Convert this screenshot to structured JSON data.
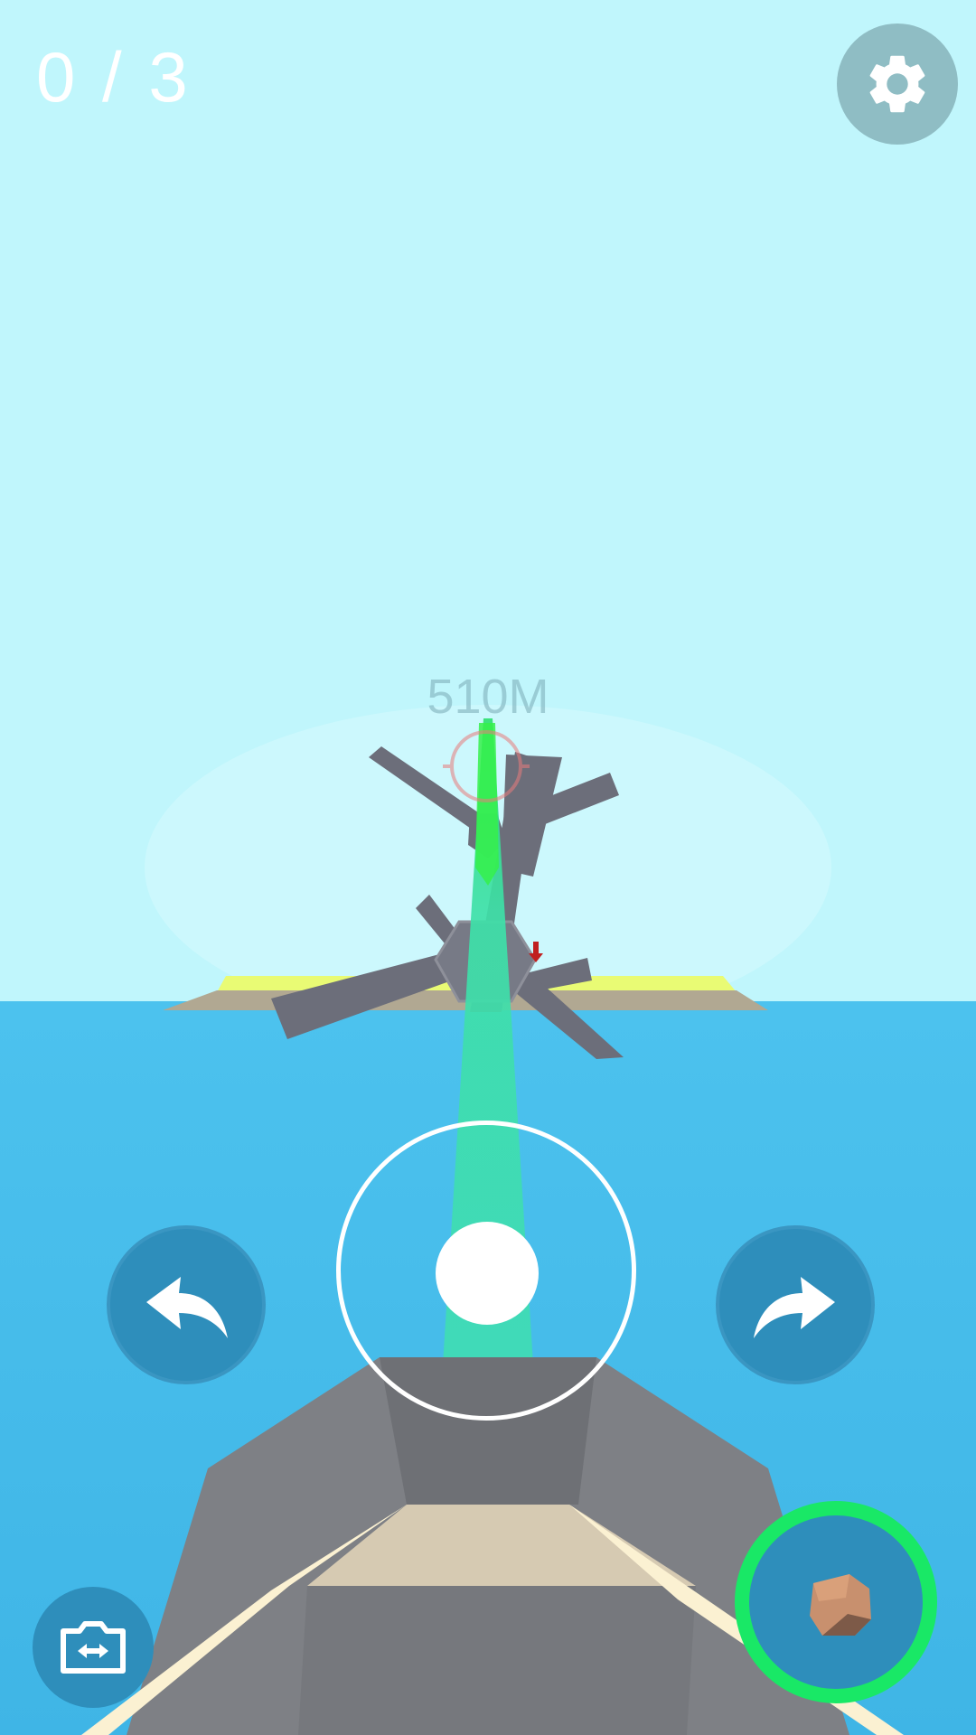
{
  "hud": {
    "progress_counter": "0 / 3",
    "target_distance": "510M"
  },
  "icons": {
    "settings": "gear-icon",
    "rotate_left": "curved-arrow-left-icon",
    "rotate_right": "curved-arrow-right-icon",
    "switch_camera": "camera-switch-icon",
    "fire": "rock-ammo-icon"
  },
  "colors": {
    "sky": "#c0f6fc",
    "sea": "#42b9ea",
    "aim_beam": "#36e8a0",
    "fire_ring": "#19e866",
    "button_blue": "#2e8ebb",
    "target_reticle": "#e87c7c"
  }
}
